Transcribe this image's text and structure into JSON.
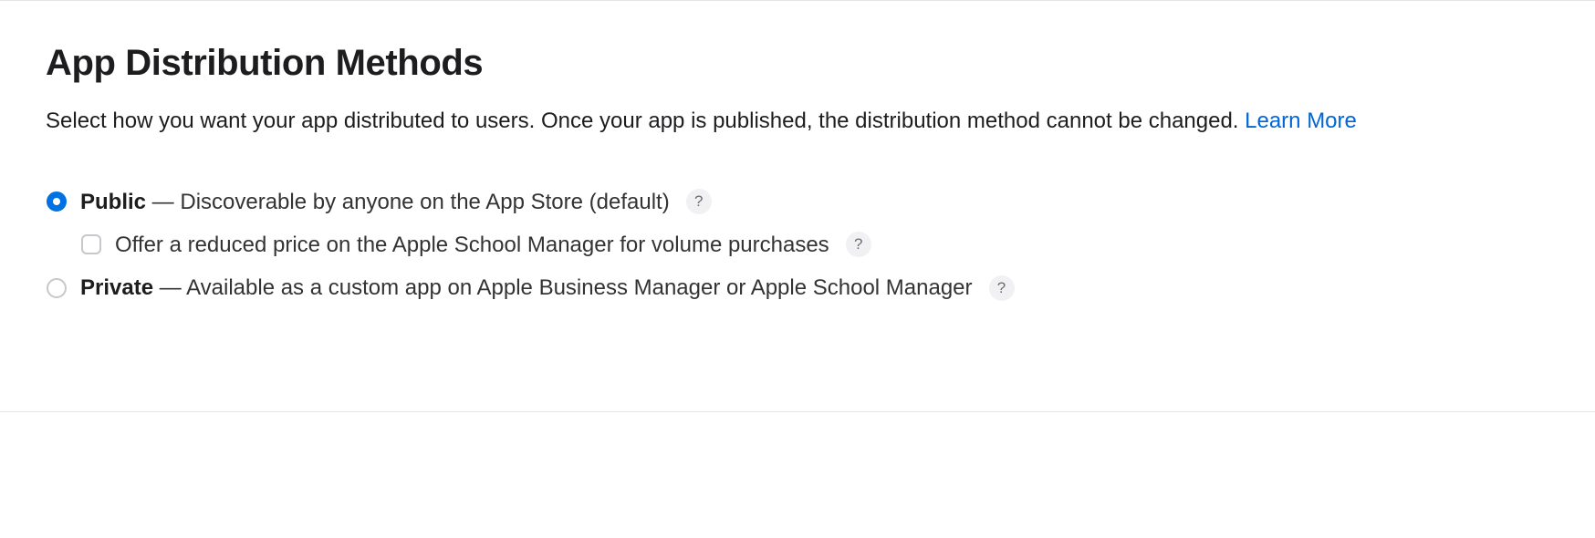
{
  "section": {
    "title": "App Distribution Methods",
    "subtitle": "Select how you want your app distributed to users. Once your app is published, the distribution method cannot be changed. ",
    "learn_more": "Learn More"
  },
  "options": {
    "public": {
      "name": "Public",
      "desc": "Discoverable by anyone on the App Store (default)",
      "help_glyph": "?",
      "selected": true,
      "reduced_price": {
        "label": "Offer a reduced price on the Apple School Manager for volume purchases",
        "help_glyph": "?",
        "checked": false
      }
    },
    "private": {
      "name": "Private",
      "desc": "Available as a custom app on Apple Business Manager or Apple School Manager",
      "help_glyph": "?",
      "selected": false
    },
    "dash_sep": " — "
  }
}
